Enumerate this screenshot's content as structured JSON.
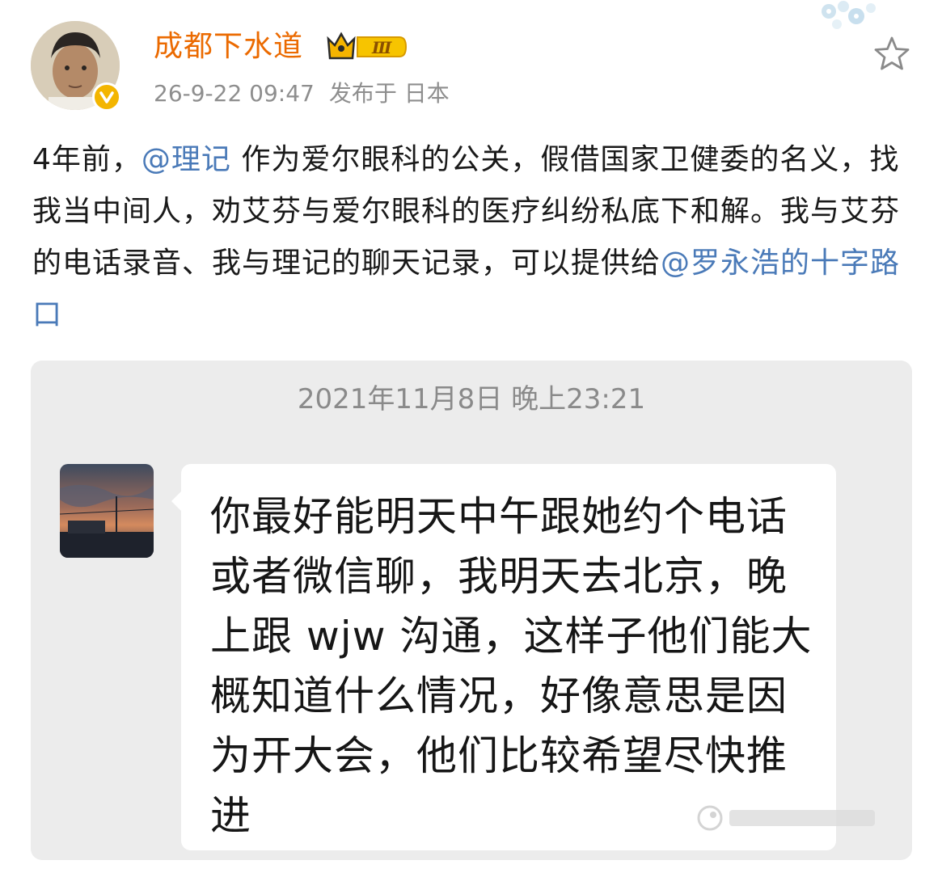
{
  "post": {
    "username": "成都下水道",
    "vip_level": "Ⅲ",
    "time": "26-9-22 09:47",
    "location": "发布于 日本",
    "text_parts": {
      "p1": "4年前，",
      "mention1": "@理记",
      "p2": " 作为爱尔眼科的公关，假借国家卫健委的名义，找我当中间人，劝艾芬与爱尔眼科的医疗纠纷私底下和解。我与艾芬的电话录音、我与理记的聊天记录，可以提供给",
      "mention2": "@罗永浩的十字路口"
    }
  },
  "chat": {
    "timestamp": "2021年11月8日 晚上23:21",
    "message": "你最好能明天中午跟她约个电话或者微信聊，我明天去北京，晚上跟 wjw 沟通，这样子他们能大概知道什么情况，好像意思是因为开大会，他们比较希望尽快推进"
  },
  "colors": {
    "username": "#eb6a00",
    "mention": "#4a7ab8",
    "meta": "#8e8e8e",
    "chat_bg": "#ececec",
    "verified": "#f3b500"
  },
  "icons": [
    "verified-v-icon",
    "vip-crown-icon",
    "star-outline-icon",
    "weibo-watermark-icon"
  ]
}
